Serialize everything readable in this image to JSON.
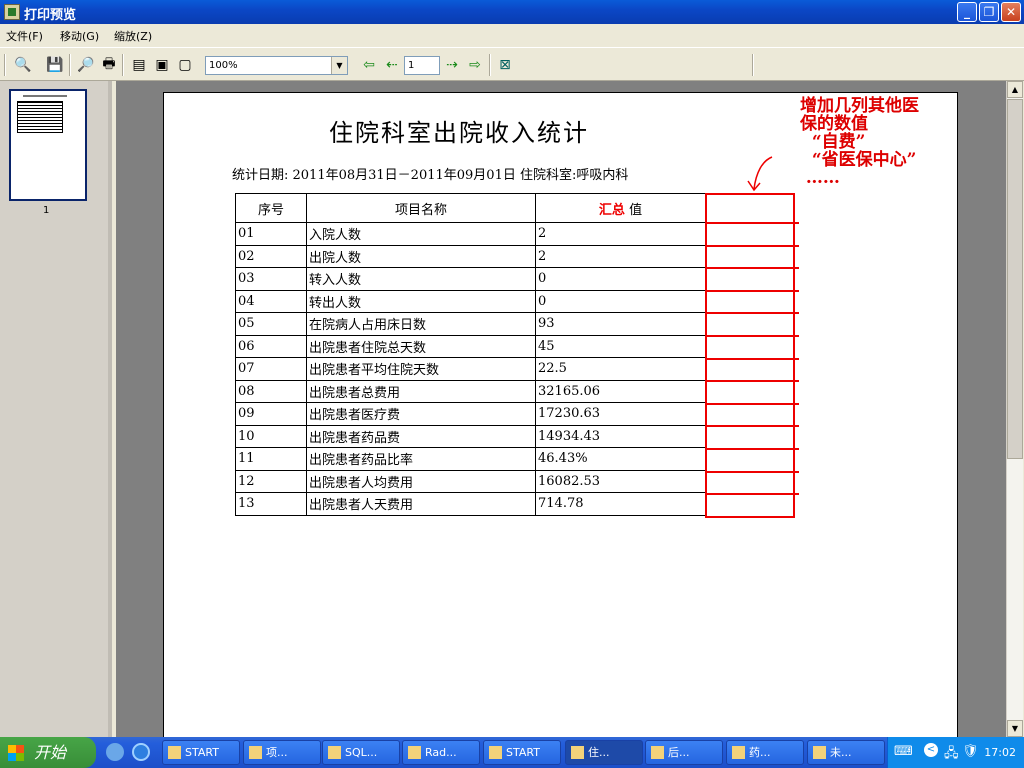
{
  "window": {
    "title": "打印预览"
  },
  "menu": [
    "文件(F)",
    "移动(G)",
    "缩放(Z)"
  ],
  "toolbar": {
    "zoom_value": "100%",
    "page_value": "1"
  },
  "thumbnail": {
    "page_label": "1"
  },
  "report": {
    "title": "住院科室出院收入统计",
    "subtitle": "统计日期: 2011年08月31日－2011年09月01日 住院科室:呼吸内科",
    "headers": [
      "序号",
      "项目名称",
      "汇总",
      "值"
    ],
    "rows": [
      [
        "01",
        "入院人数",
        "2"
      ],
      [
        "02",
        "出院人数",
        "2"
      ],
      [
        "03",
        "转入人数",
        "0"
      ],
      [
        "04",
        "转出人数",
        "0"
      ],
      [
        "05",
        "在院病人占用床日数",
        "93"
      ],
      [
        "06",
        "出院患者住院总天数",
        "45"
      ],
      [
        "07",
        "出院患者平均住院天数",
        "22.5"
      ],
      [
        "08",
        "出院患者总费用",
        "32165.06"
      ],
      [
        "09",
        "出院患者医疗费",
        "17230.63"
      ],
      [
        "10",
        "出院患者药品费",
        "14934.43"
      ],
      [
        "11",
        "出院患者药品比率",
        "46.43%"
      ],
      [
        "12",
        "出院患者人均费用",
        "16082.53"
      ],
      [
        "13",
        "出院患者人天费用",
        "714.78"
      ]
    ],
    "annotation": "增加几列其他医\n保的数值\n  “自费”\n  “省医保中心”\n ……"
  },
  "taskbar": {
    "start_label": "开始",
    "tasks": [
      "START",
      "项...",
      "SQL...",
      "Rad...",
      "START",
      "住...",
      "后...",
      "药...",
      "未..."
    ],
    "clock": "17:02"
  },
  "colors": {
    "annotation_red": "#e00000",
    "title_blue": "#0a5bd8"
  }
}
